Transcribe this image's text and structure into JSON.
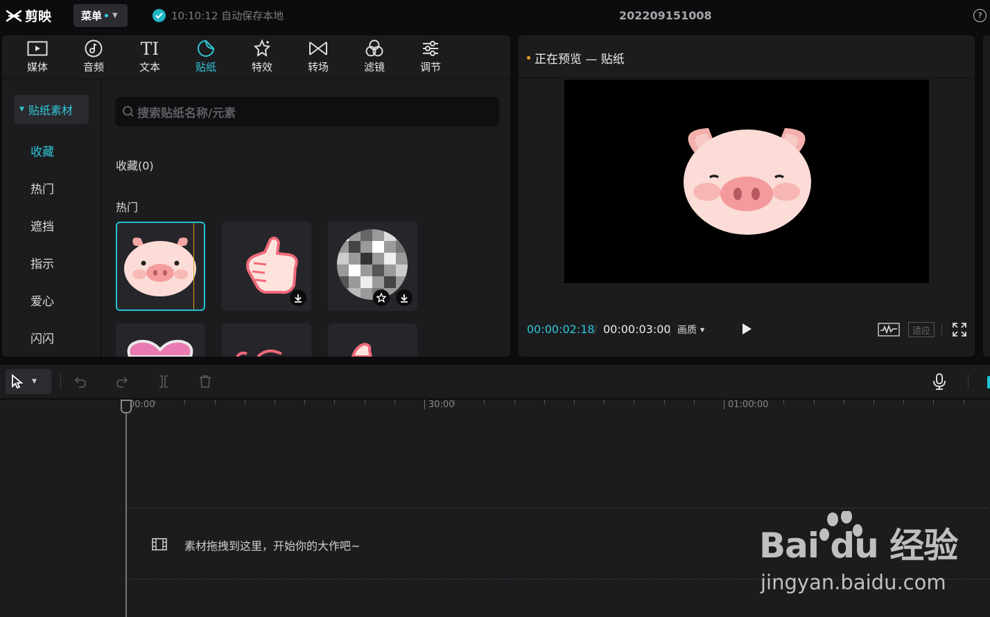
{
  "app": {
    "logo_text": "剪映",
    "menu_label": "菜单",
    "save_status": "10:10:12 自动保存本地",
    "project_name": "202209151008"
  },
  "tabs": [
    {
      "label": "媒体",
      "icon": "media-icon"
    },
    {
      "label": "音频",
      "icon": "audio-icon"
    },
    {
      "label": "文本",
      "icon": "text-icon"
    },
    {
      "label": "贴纸",
      "icon": "sticker-icon",
      "active": true
    },
    {
      "label": "特效",
      "icon": "effects-icon"
    },
    {
      "label": "转场",
      "icon": "transition-icon"
    },
    {
      "label": "滤镜",
      "icon": "filter-icon"
    },
    {
      "label": "调节",
      "icon": "adjust-icon"
    }
  ],
  "sidebar": {
    "header": "贴纸素材",
    "items": [
      "收藏",
      "热门",
      "遮挡",
      "指示",
      "爱心",
      "闪闪"
    ]
  },
  "search": {
    "placeholder": "搜索贴纸名称/元素"
  },
  "sections": {
    "favorites": "收藏(0)",
    "hot": "热门"
  },
  "preview": {
    "title": "正在预览 — 贴纸",
    "current_time": "00:00:02:18",
    "separator": "/",
    "total_time": "00:00:03:00",
    "quality_label": "画质",
    "fit_label": "适应"
  },
  "timeline": {
    "ruler_labels": [
      "00:00",
      "30:00",
      "01:00:00"
    ],
    "drop_hint": "素材拖拽到这里，开始你的大作吧~"
  },
  "watermark": {
    "brand": "Bai du 经验",
    "url": "jingyan.baidu.com"
  },
  "colors": {
    "accent": "#2fc8d8",
    "panel": "#1c1c1f",
    "background": "#0c0c0e"
  }
}
